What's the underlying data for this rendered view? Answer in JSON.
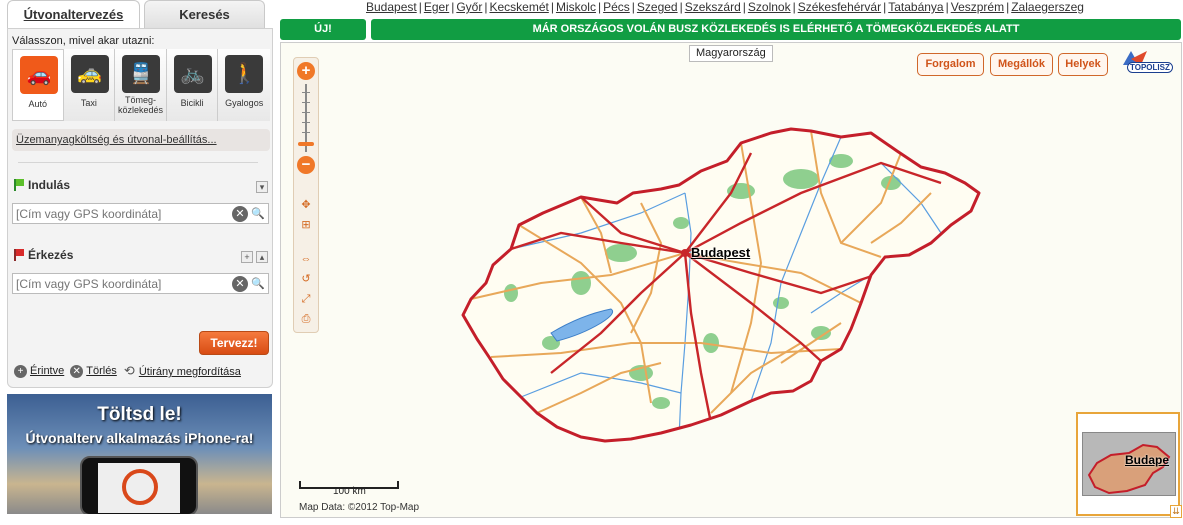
{
  "tabs": {
    "route_planning": "Útvonaltervezés",
    "search": "Keresés"
  },
  "panel": {
    "prompt": "Válasszon, mivel akar utazni:",
    "modes": [
      {
        "label": "Autó",
        "icon": "car-icon"
      },
      {
        "label": "Taxi",
        "icon": "taxi-icon"
      },
      {
        "label": "Tömeg-közlekedés",
        "icon": "train-icon"
      },
      {
        "label": "Bicikli",
        "icon": "bicycle-icon"
      },
      {
        "label": "Gyalogos",
        "icon": "pedestrian-icon"
      }
    ],
    "fuel_link": "Üzemanyagköltség és útvonal-beállítás...",
    "departure_label": "Indulás",
    "departure_placeholder": "[Cím vagy GPS koordináta]",
    "arrival_label": "Érkezés",
    "arrival_placeholder": "[Cím vagy GPS koordináta]",
    "plan_button": "Tervezz!",
    "touch_link": "Érintve",
    "delete_link": "Törlés",
    "reverse_link": "Útirány megfordítása"
  },
  "ad": {
    "title": "Töltsd le!",
    "subtitle": "Útvonalterv alkalmazás iPhone-ra!"
  },
  "cities": [
    "Budapest",
    "Eger",
    "Győr",
    "Kecskemét",
    "Miskolc",
    "Pécs",
    "Szeged",
    "Szekszárd",
    "Szolnok",
    "Székesfehérvár",
    "Tatabánya",
    "Veszprém",
    "Zalaegerszeg"
  ],
  "banner": {
    "new_label": "ÚJ!",
    "news": "MÁR ORSZÁGOS VOLÁN BUSZ KÖZLEKEDÉS IS ELÉRHETŐ A TÖMEGKÖZLEKEDÉS ALATT"
  },
  "map": {
    "country_tip": "Magyarország",
    "buttons": {
      "traffic": "Forgalom",
      "stops": "Megállók",
      "places": "Helyek"
    },
    "brand": "TOPOLISZ",
    "city_label": "Budapest",
    "scale_label": "100 km",
    "attribution": "Map Data: ©2012 Top-Map",
    "overview_label": "Budape"
  },
  "colors": {
    "accent": "#f05a1a",
    "banner_green": "#119d43",
    "road_major": "#c8262a",
    "road_minor": "#e8a85a",
    "forest": "#8fcf8f",
    "water": "#5a9ee0"
  }
}
